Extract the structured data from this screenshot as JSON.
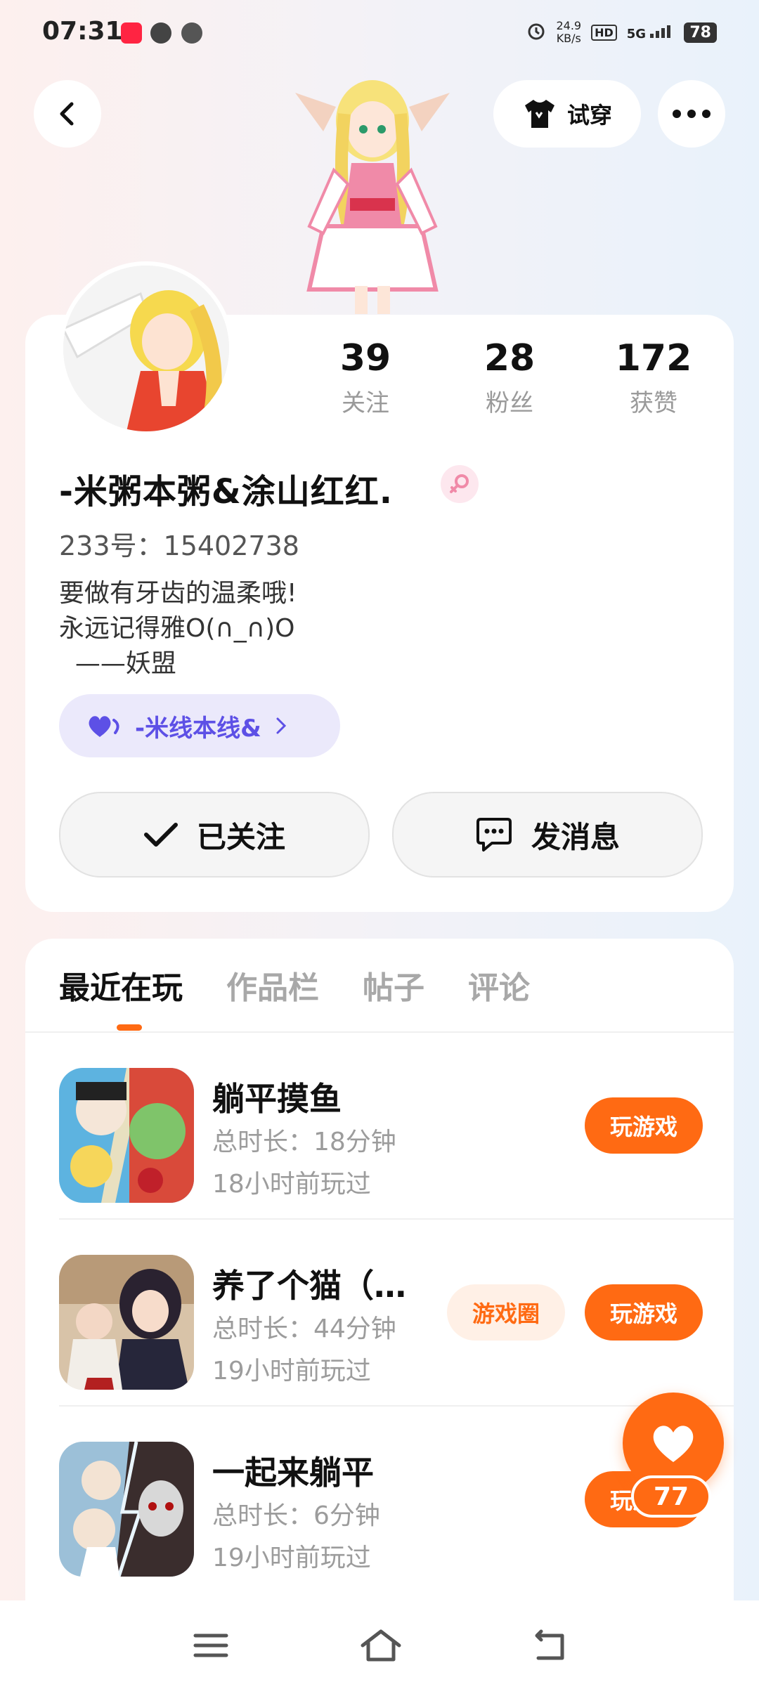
{
  "status": {
    "time": "07:31",
    "net_speed": "24.9",
    "net_unit": "KB/s",
    "hd": "HD",
    "signal": "5G",
    "battery": "78"
  },
  "topbar": {
    "try_on_label": "试穿"
  },
  "profile": {
    "stats": [
      {
        "num": "39",
        "label": "关注"
      },
      {
        "num": "28",
        "label": "粉丝"
      },
      {
        "num": "172",
        "label": "获赞"
      }
    ],
    "name": "-米粥本粥&涂山红红.",
    "uid": "233号：15402738",
    "bio": "要做有牙齿的温柔哦!\n永远记得雅O(∩_∩)O\n  ——妖盟",
    "tag": "-米线本线&",
    "follow_label": "已关注",
    "message_label": "发消息"
  },
  "tabs": [
    "最近在玩",
    "作品栏",
    "帖子",
    "评论"
  ],
  "games": [
    {
      "title": "躺平摸鱼",
      "duration": "总时长：18分钟",
      "last": "18小时前玩过",
      "play": "玩游戏"
    },
    {
      "title": "养了个猫（…",
      "duration": "总时长：44分钟",
      "last": "19小时前玩过",
      "circle": "游戏圈",
      "play": "玩游戏"
    },
    {
      "title": "一起来躺平",
      "duration": "总时长：6分钟",
      "last": "19小时前玩过",
      "play": "玩游戏"
    }
  ],
  "like_count": "77",
  "colors": {
    "accent": "#ff6a13",
    "tag": "#5d50e6"
  }
}
